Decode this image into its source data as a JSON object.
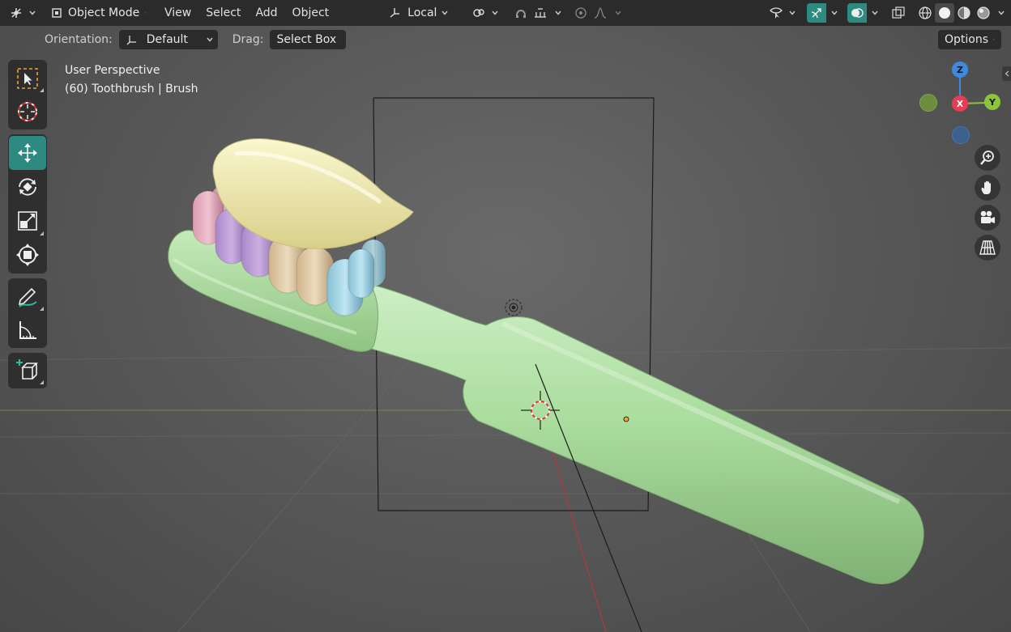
{
  "header": {
    "mode_label": "Object Mode",
    "menus": [
      "View",
      "Select",
      "Add",
      "Object"
    ],
    "transform_pivot_label": "Local",
    "options_label": "Options"
  },
  "tool_settings": {
    "orientation_label": "Orientation:",
    "orientation_value": "Default",
    "drag_label": "Drag:",
    "drag_value": "Select Box"
  },
  "viewport": {
    "view_name": "User Perspective",
    "object_info": "(60) Toothbrush | Brush"
  },
  "gizmo": {
    "z": "Z",
    "x": "X",
    "y": "Y"
  },
  "toolbar": {
    "tools": [
      "select-box",
      "cursor",
      "move",
      "rotate",
      "scale",
      "transform",
      "annotate",
      "measure",
      "add-cube"
    ],
    "active_tool": "move"
  },
  "colors": {
    "accent": "#2d8a80",
    "brush_body": "#a9dca0",
    "paste": "#f3eeb0",
    "axis_x": "#e83c52",
    "axis_y": "#8cc43b",
    "axis_z": "#3f8ae0"
  }
}
